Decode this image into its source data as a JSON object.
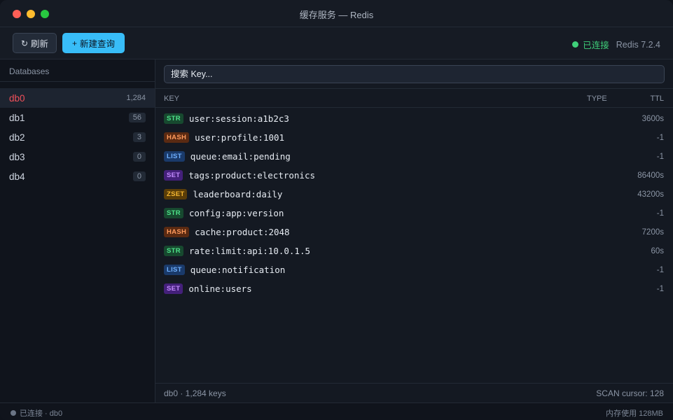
{
  "window": {
    "title": "缓存服务 — Redis"
  },
  "toolbar": {
    "refresh_label": "刷新",
    "new_query_label": "新建查询",
    "connection_status": "已连接",
    "version": "Redis 7.2.4"
  },
  "sidebar": {
    "heading": "Databases",
    "databases": [
      {
        "name": "db0",
        "count": "1,284",
        "active": true
      },
      {
        "name": "db1",
        "count": "56"
      },
      {
        "name": "db2",
        "count": "3"
      },
      {
        "name": "db3",
        "count": "0"
      },
      {
        "name": "db4",
        "count": "0"
      }
    ]
  },
  "search": {
    "placeholder": "搜索 Key..."
  },
  "table": {
    "headers": {
      "key": "KEY",
      "type": "TYPE",
      "ttl": "TTL"
    },
    "rows": [
      {
        "type": "STR",
        "key": "user:session:a1b2c3",
        "ttl": "3600s"
      },
      {
        "type": "HASH",
        "key": "user:profile:1001",
        "ttl": "-1"
      },
      {
        "type": "LIST",
        "key": "queue:email:pending",
        "ttl": "-1"
      },
      {
        "type": "SET",
        "key": "tags:product:electronics",
        "ttl": "86400s"
      },
      {
        "type": "ZSET",
        "key": "leaderboard:daily",
        "ttl": "43200s"
      },
      {
        "type": "STR",
        "key": "config:app:version",
        "ttl": "-1"
      },
      {
        "type": "HASH",
        "key": "cache:product:2048",
        "ttl": "7200s"
      },
      {
        "type": "STR",
        "key": "rate:limit:api:10.0.1.5",
        "ttl": "60s"
      },
      {
        "type": "LIST",
        "key": "queue:notification",
        "ttl": "-1"
      },
      {
        "type": "SET",
        "key": "online:users",
        "ttl": "-1"
      }
    ]
  },
  "main_footer": {
    "summary": "db0 · 1,284 keys",
    "cursor": "SCAN cursor: 128"
  },
  "statusbar": {
    "left": "已连接 · db0",
    "right": "内存使用 128MB"
  },
  "colors": {
    "accent": "#38bdf8",
    "connected": "#3fd07a",
    "active_db": "#f0505a"
  }
}
